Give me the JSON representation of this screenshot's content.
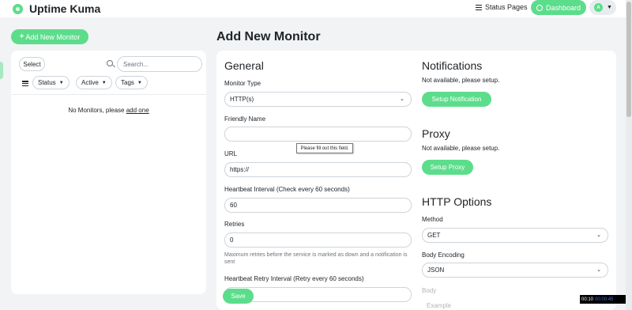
{
  "header": {
    "app_title": "Uptime Kuma",
    "status_pages_label": "Status Pages",
    "dashboard_label": "Dashboard",
    "avatar_initial": "A"
  },
  "sidebar": {
    "add_monitor_label": "Add New Monitor",
    "select_label": "Select",
    "search_placeholder": "Search...",
    "filters": [
      "Status",
      "Active",
      "Tags"
    ],
    "empty_prefix": "No Monitors, please",
    "empty_link": "add one"
  },
  "page": {
    "title": "Add New Monitor"
  },
  "general": {
    "heading": "General",
    "monitor_type_label": "Monitor Type",
    "monitor_type_value": "HTTP(s)",
    "friendly_name_label": "Friendly Name",
    "friendly_name_value": "",
    "tooltip": "Please fill out this field.",
    "url_label": "URL",
    "url_value": "https://",
    "heartbeat_label": "Heartbeat Interval (Check every 60 seconds)",
    "heartbeat_value": "60",
    "retries_label": "Retries",
    "retries_value": "0",
    "retries_help": "Maximum retries before the service is marked as down and a notification is sent",
    "retry_interval_label": "Heartbeat Retry Interval (Retry every 60 seconds)",
    "save_label": "Save"
  },
  "notifications": {
    "heading": "Notifications",
    "text": "Not available, please setup.",
    "button": "Setup Notification"
  },
  "proxy": {
    "heading": "Proxy",
    "text": "Not available, please setup.",
    "button": "Setup Proxy"
  },
  "http_options": {
    "heading": "HTTP Options",
    "method_label": "Method",
    "method_value": "GET",
    "body_encoding_label": "Body Encoding",
    "body_encoding_value": "JSON",
    "body_label": "Body",
    "body_placeholder": "Example"
  },
  "video_time": {
    "current": "00:10",
    "rest": "00:00:45"
  },
  "colors": {
    "accent": "#5cdd8b",
    "background": "#f1f3f5",
    "card": "#ffffff"
  },
  "icons": [
    "logo-icon",
    "menu-icon",
    "dashboard-icon",
    "avatar",
    "chevron-down-icon",
    "plus-icon",
    "search-icon",
    "filter-icon"
  ]
}
